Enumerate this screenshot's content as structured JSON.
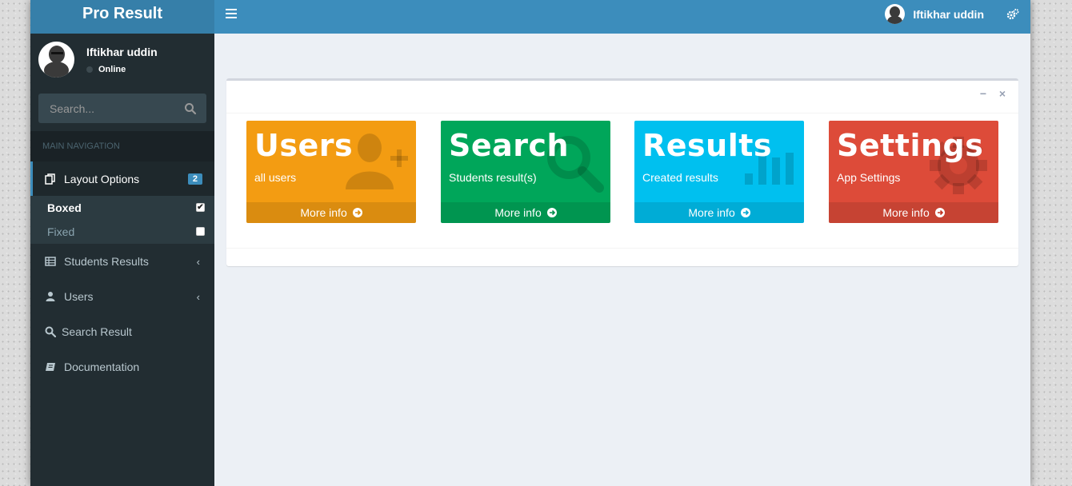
{
  "header": {
    "logo": "Pro Result",
    "user_name": "Iftikhar uddin"
  },
  "sidebar": {
    "user_name": "Iftikhar uddin",
    "status": "Online",
    "search_placeholder": "Search...",
    "nav_header": "MAIN NAVIGATION",
    "items": [
      {
        "label": "Layout Options",
        "badge": "2"
      },
      {
        "label": "Students Results",
        "chevron": "‹"
      },
      {
        "label": "Users",
        "chevron": "‹"
      },
      {
        "label": "Search Result"
      },
      {
        "label": "Documentation"
      }
    ],
    "layout_sub": [
      {
        "label": "Boxed",
        "checked": true,
        "mark": "✔"
      },
      {
        "label": "Fixed",
        "checked": false,
        "mark": ""
      }
    ]
  },
  "box": {
    "minimize": "−",
    "close": "×"
  },
  "tiles": [
    {
      "title": "Users",
      "subtitle": "all users",
      "footer": "More info",
      "color": "#f39c12",
      "icon": "add-user-icon"
    },
    {
      "title": "Search",
      "subtitle": "Students result(s)",
      "footer": "More info",
      "color": "#00a65a",
      "icon": "search-icon"
    },
    {
      "title": "Results",
      "subtitle": "Created results",
      "footer": "More info",
      "color": "#00c0ef",
      "icon": "bar-chart-icon"
    },
    {
      "title": "Settings",
      "subtitle": "App Settings",
      "footer": "More info",
      "color": "#dd4b39",
      "icon": "gear-icon"
    }
  ]
}
